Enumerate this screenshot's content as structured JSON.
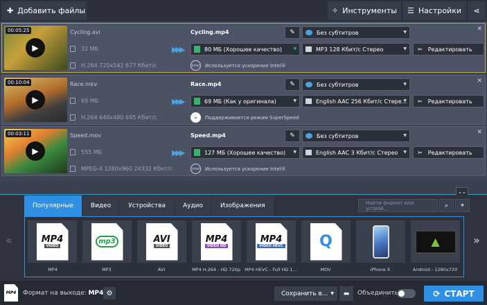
{
  "toolbar": {
    "add_files": "Добавить файлы",
    "tools": "Инструменты",
    "settings": "Настройки"
  },
  "files": [
    {
      "time": "00:05:25",
      "name": "Cycling.avi",
      "size": "32 МБ",
      "info": "H.264 720x542 677 Кбит/с",
      "output_name": "Cycling.mp4",
      "output_size": "80 МБ (Хорошее качество)",
      "subtitles": "Без субтитров",
      "audio": "MP3 128 Кбит/с Стерео",
      "edit": "Редактировать",
      "note": "Используется ускорение Intel®",
      "note_logo": "intel"
    },
    {
      "time": "00:10:04",
      "name": "Race.mkv",
      "size": "69 МБ",
      "info": "H.264 640x480 695 Кбит/с",
      "output_name": "Race.mp4",
      "output_size": "69 МБ (Как у оригинала)",
      "subtitles": "Без субтитров",
      "audio": "English AAC 256 Кбит/с Стере...",
      "edit": "Редактировать",
      "note": "Поддерживается режим SuperSpeed",
      "note_logo": ""
    },
    {
      "time": "00:03:11",
      "name": "Speed.mov",
      "size": "555 МБ",
      "info": "MPEG-4 1280x960 24332 Кбит/с",
      "output_name": "Speed.mp4",
      "output_size": "127 МБ (Хорошее качество)",
      "subtitles": "Без субтитров",
      "audio": "English AAC 3 Кбит/с Стерео",
      "edit": "Редактировать",
      "note": "Используется ускорение Intel®",
      "note_logo": "intel"
    }
  ],
  "tabs": [
    "Популярные",
    "Видео",
    "Устройства",
    "Аудио",
    "Изображения"
  ],
  "search_placeholder": "Найти формат или устрой...",
  "formats": [
    {
      "label": "MP4",
      "big": "MP4",
      "sub": "VIDEO"
    },
    {
      "label": "MP3",
      "big": "mp3",
      "sub": ""
    },
    {
      "label": "AVI",
      "big": "AVI",
      "sub": "VIDEO"
    },
    {
      "label": "MP4 H.264 - HD 720p",
      "big": "MP4",
      "sub": "VIDEO HD"
    },
    {
      "label": "MP4 HEVC - Full HD 1...",
      "big": "MP4",
      "sub": "VIDEO HEVC"
    },
    {
      "label": "MOV",
      "big": "Q",
      "sub": ""
    },
    {
      "label": "iPhone X",
      "big": "",
      "sub": ""
    },
    {
      "label": "Android - 1280x720",
      "big": "",
      "sub": ""
    }
  ],
  "bottom": {
    "format_label": "Формат на выходе:",
    "format_value": "MP4",
    "save_label": "Сохранить в...",
    "merge_label": "Объединить:",
    "start_label": "СТАРТ"
  }
}
